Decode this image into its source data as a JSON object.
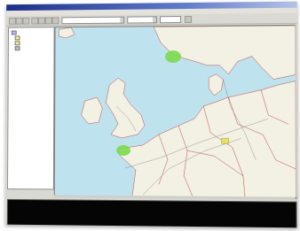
{
  "window": {
    "title": ""
  },
  "menu": {
    "items": [
      "",
      "",
      "",
      "",
      "",
      "",
      ""
    ]
  },
  "toolbar": {
    "scale_value": "",
    "layer_value": "",
    "coord_value": ""
  },
  "layer_tree": {
    "items": [
      {
        "label": "",
        "color": "#b9b1ff"
      },
      {
        "label": "",
        "color": "#f6f07a"
      },
      {
        "label": "",
        "color": "#f6f07a"
      },
      {
        "label": "",
        "color": "#c0c0c0"
      }
    ]
  },
  "map": {
    "land_color": "#f3f1e3",
    "sea_color": "#bfe2ef",
    "highlight_color": "#7cdc4c",
    "selection_color": "#e7e264",
    "border_color": "#b54b4b",
    "cities": []
  },
  "console": {
    "text_color": "#3dff3d",
    "lines": [
      {
        "c1": "",
        "c2": "",
        "c3": "",
        "c4": ""
      },
      {
        "c1": "",
        "c2": "",
        "c3": "",
        "c4": ""
      },
      {
        "c1": "",
        "c2": "",
        "c3": "",
        "c4": ""
      },
      {
        "c1": "",
        "c2": "",
        "c3": "",
        "c4": ""
      }
    ]
  }
}
